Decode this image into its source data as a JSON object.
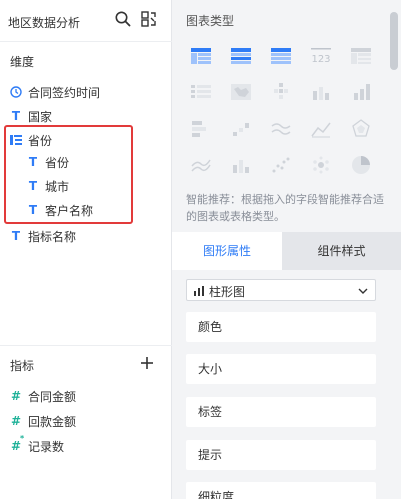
{
  "left_panel": {
    "title": "地区数据分析",
    "dimensions": {
      "title": "维度",
      "fields": [
        {
          "label": "合同签约时间",
          "icon": "clock-icon"
        },
        {
          "label": "国家",
          "icon": "text-type-icon"
        },
        {
          "label": "省份",
          "icon": "hierarchy-icon"
        },
        {
          "label": "省份",
          "icon": "text-type-icon"
        },
        {
          "label": "城市",
          "icon": "text-type-icon"
        },
        {
          "label": "客户名称",
          "icon": "text-type-icon"
        },
        {
          "label": "指标名称",
          "icon": "text-type-icon"
        }
      ]
    },
    "metrics": {
      "title": "指标",
      "fields": [
        {
          "label": "合同金额",
          "icon": "number-type-icon"
        },
        {
          "label": "回款金额",
          "icon": "number-type-icon"
        },
        {
          "label": "记录数",
          "icon": "count-type-icon"
        }
      ]
    }
  },
  "right_panel": {
    "chart_type_title": "图表类型",
    "hint": "智能推荐：根据拖入的字段智能推荐合适的图表或表格类型。",
    "tabs": [
      {
        "label": "图形属性",
        "active": true
      },
      {
        "label": "组件样式",
        "active": false
      }
    ],
    "chart_selector": {
      "value": "柱形图"
    },
    "properties": [
      "颜色",
      "大小",
      "标签",
      "提示",
      "细粒度"
    ]
  },
  "colors": {
    "accent": "#2f7cf6",
    "number_field": "#1fb299",
    "highlight": "#e23a3a"
  }
}
